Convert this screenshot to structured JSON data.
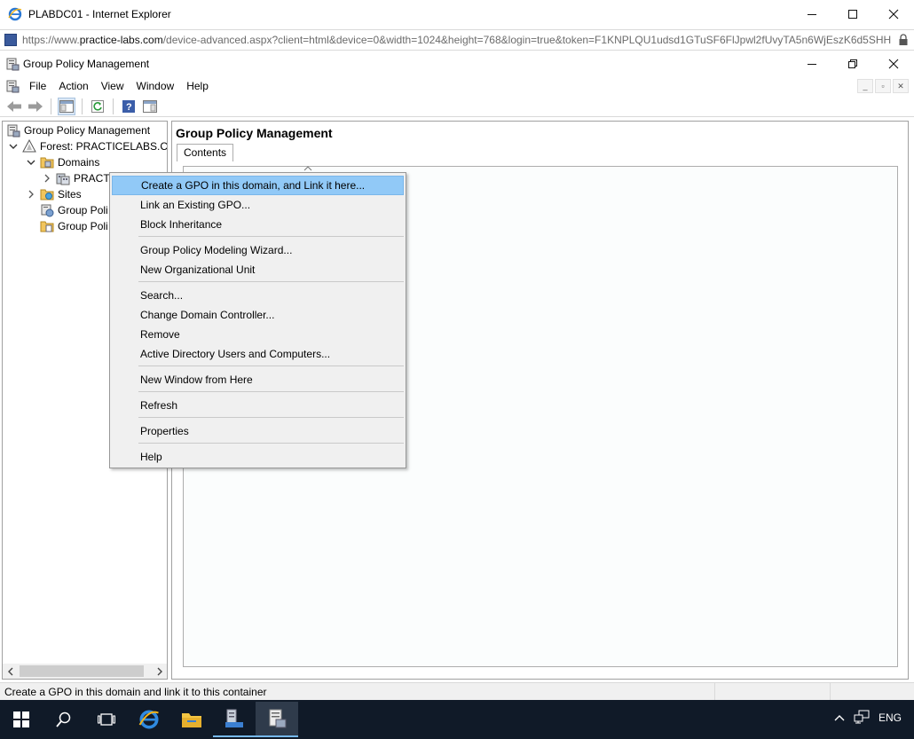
{
  "browser": {
    "title": "PLABDC01 - Internet Explorer",
    "url_prefix": "https://www.",
    "url_host": "practice-labs.com",
    "url_rest": "/device-advanced.aspx?client=html&device=0&width=1024&height=768&login=true&token=F1KNPLQU1udsd1GTuSF6FlJpwl2fUvyTA5n6WjEszK6d5SHH"
  },
  "mmc": {
    "title": "Group Policy Management",
    "menu": [
      "File",
      "Action",
      "View",
      "Window",
      "Help"
    ]
  },
  "tree": {
    "root": "Group Policy Management",
    "forest": "Forest: PRACTICELABS.CO",
    "domains": "Domains",
    "domain_item": "PRACT",
    "sites": "Sites",
    "gp1": "Group Poli",
    "gp2": "Group Poli"
  },
  "right": {
    "title": "Group Policy Management",
    "tab": "Contents"
  },
  "context_menu": {
    "items": [
      "Create a GPO in this domain, and Link it here...",
      "Link an Existing GPO...",
      "Block Inheritance",
      "Group Policy Modeling Wizard...",
      "New Organizational Unit",
      "Search...",
      "Change Domain Controller...",
      "Remove",
      "Active Directory Users and Computers...",
      "New Window from Here",
      "Refresh",
      "Properties",
      "Help"
    ],
    "highlighted_index": 0
  },
  "status": {
    "text": "Create a GPO in this domain and link it to this container"
  },
  "taskbar": {
    "lang": "ENG"
  },
  "colors": {
    "menu_highlight": "#91c9f7",
    "taskbar": "#101a28"
  }
}
